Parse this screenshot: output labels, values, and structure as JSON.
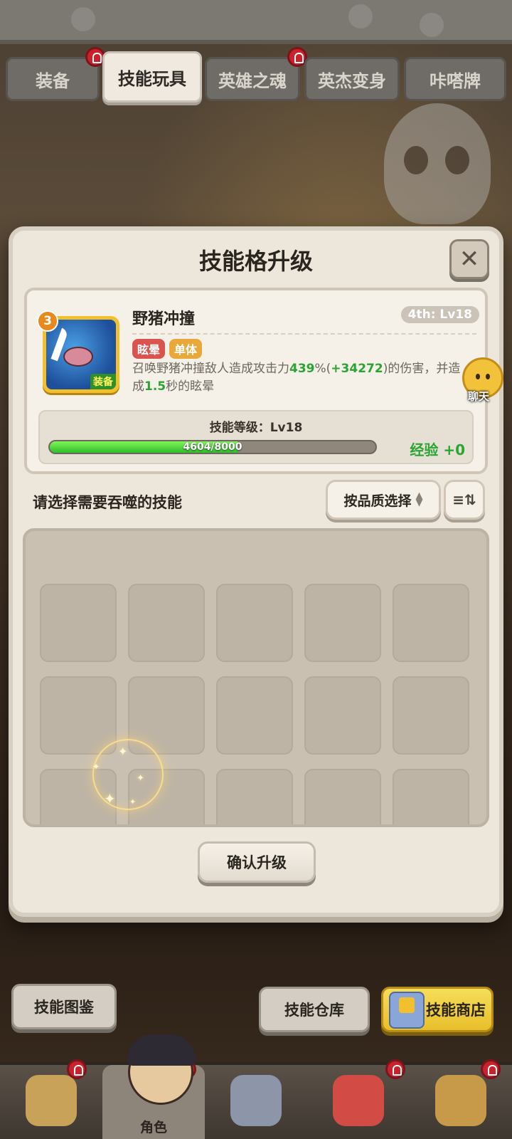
{
  "tabs": [
    {
      "label": "装备",
      "badge": true
    },
    {
      "label": "技能玩具",
      "badge": false,
      "active": true
    },
    {
      "label": "英雄之魂",
      "badge": true
    },
    {
      "label": "英杰变身",
      "badge": false
    },
    {
      "label": "咔嗒牌",
      "badge": false
    }
  ],
  "modal": {
    "title": "技能格升级",
    "close_icon": "close-icon"
  },
  "skill": {
    "name": "野猪冲撞",
    "tier": "4th: Lv18",
    "level_badge": "3",
    "equip_tag": "装备",
    "tags": [
      {
        "label": "眩晕",
        "color": "#d9534f"
      },
      {
        "label": "单体",
        "color": "#e9a93a"
      }
    ],
    "desc_part1": "召唤野猪冲撞敌人造成攻击力",
    "desc_pct": "439",
    "desc_pct_sign": "%(",
    "desc_bonus": "+34272",
    "desc_part2": ")的伤害，并造成",
    "desc_secs": "1.5",
    "desc_part3": "秒的眩晕",
    "level_label": "技能等级：Lv18",
    "exp_text": "4604/8000",
    "exp_current": 4604,
    "exp_max": 8000,
    "exp_gain": "经验 +0"
  },
  "chat": {
    "label": "聊天"
  },
  "selection": {
    "prompt": "请选择需要吞噬的技能",
    "quality_button": "按品质选择",
    "sort_icon": "sort-icon"
  },
  "confirm_button": "确认升级",
  "actions": {
    "codex": "技能图鉴",
    "warehouse": "技能仓库",
    "shop": "技能商店"
  },
  "bottom_nav": [
    {
      "label": "",
      "icon": "lion-icon",
      "badge": true
    },
    {
      "label": "角色",
      "icon": "hero-icon",
      "badge": true,
      "active": true
    },
    {
      "label": "",
      "icon": "sword-icon",
      "badge": false
    },
    {
      "label": "",
      "icon": "dino-icon",
      "badge": true
    },
    {
      "label": "",
      "icon": "totem-icon",
      "badge": true
    }
  ],
  "colors": {
    "accent_green": "#2aa432",
    "badge_red": "#c8232c",
    "panel": "#ece6db"
  }
}
